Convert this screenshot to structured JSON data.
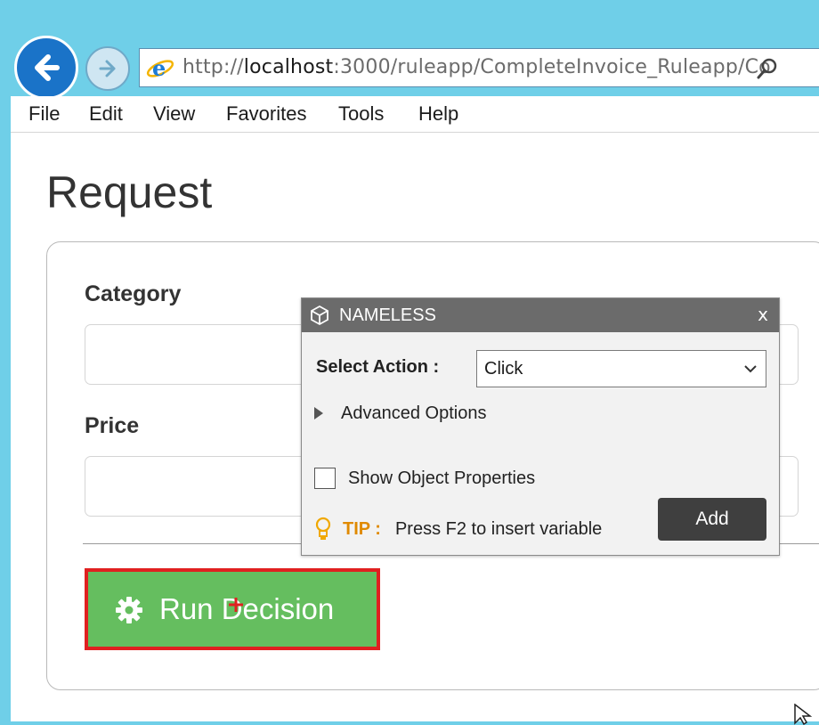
{
  "browser": {
    "url_prefix": "http://",
    "url_host": "localhost",
    "url_rest": ":3000/ruleapp/CompleteInvoice_Ruleapp/Co",
    "url_overflow": "«",
    "icons": {
      "back": "back-arrow-icon",
      "forward": "forward-arrow-icon",
      "browser": "ie-logo-icon",
      "search": "search-icon"
    }
  },
  "menu": {
    "items": [
      "File",
      "Edit",
      "View",
      "Favorites",
      "Tools",
      "Help"
    ]
  },
  "page": {
    "title": "Request",
    "fields": [
      {
        "label": "Category",
        "value": ""
      },
      {
        "label": "Price",
        "value": ""
      }
    ],
    "run_button": {
      "label": "Run Decision",
      "icon": "gear-icon",
      "highlight_color": "#e02020",
      "button_color": "#65be5f"
    }
  },
  "popup": {
    "title": "NAMELESS",
    "close_label": "x",
    "select_action_label": "Select Action :",
    "select_action_value": "Click",
    "advanced_options_label": "Advanced Options",
    "show_props_label": "Show Object Properties",
    "show_props_checked": false,
    "tip_label": "TIP :",
    "tip_text": "Press F2 to insert variable",
    "add_label": "Add"
  }
}
